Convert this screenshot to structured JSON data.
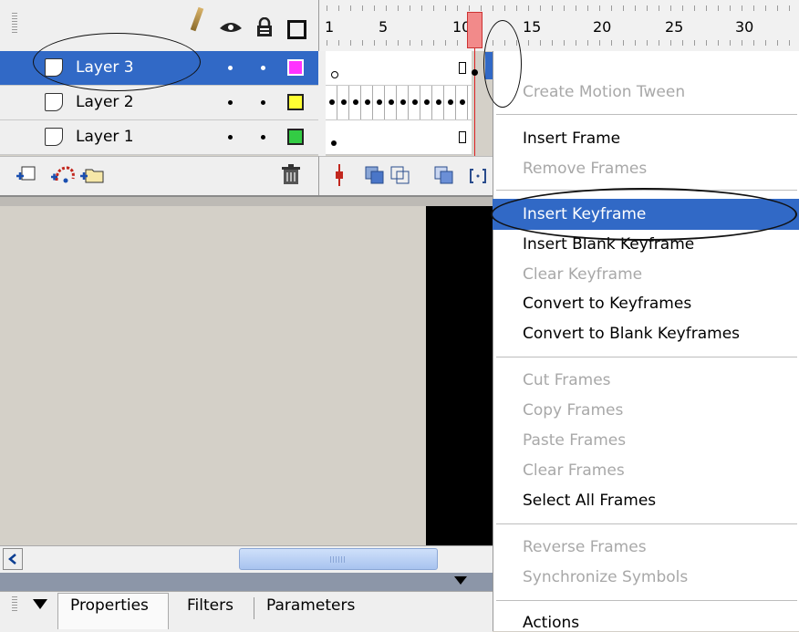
{
  "ruler": {
    "numbers": [
      "1",
      "5",
      "10",
      "15",
      "20",
      "25",
      "30"
    ]
  },
  "layers": [
    {
      "name": "Layer 3",
      "selected": true,
      "color": "#ff33ff"
    },
    {
      "name": "Layer 2",
      "selected": false,
      "color": "#ffff33"
    },
    {
      "name": "Layer 1",
      "selected": false,
      "color": "#33cc44"
    }
  ],
  "accent": "#3169c6",
  "context_menu": {
    "items": [
      {
        "label": "Create Motion Tween",
        "enabled": false
      },
      {
        "label": "Insert Frame",
        "enabled": true
      },
      {
        "label": "Remove Frames",
        "enabled": false
      },
      {
        "label": "Insert Keyframe",
        "enabled": true,
        "highlighted": true
      },
      {
        "label": "Insert Blank Keyframe",
        "enabled": true
      },
      {
        "label": "Clear Keyframe",
        "enabled": false
      },
      {
        "label": "Convert to Keyframes",
        "enabled": true
      },
      {
        "label": "Convert to Blank Keyframes",
        "enabled": true
      },
      {
        "label": "Cut Frames",
        "enabled": false
      },
      {
        "label": "Copy Frames",
        "enabled": false
      },
      {
        "label": "Paste Frames",
        "enabled": false
      },
      {
        "label": "Clear Frames",
        "enabled": false
      },
      {
        "label": "Select All Frames",
        "enabled": true
      },
      {
        "label": "Reverse Frames",
        "enabled": false
      },
      {
        "label": "Synchronize Symbols",
        "enabled": false
      },
      {
        "label": "Actions",
        "enabled": true
      }
    ]
  },
  "panel_tabs": [
    "Properties",
    "Filters",
    "Parameters"
  ],
  "icons": [
    "eye-icon",
    "lock-icon",
    "outline-icon",
    "layer-icon",
    "pencil-icon",
    "add-layer-icon",
    "add-guide-layer-icon",
    "insert-folder-icon",
    "trash-icon",
    "center-frame-icon",
    "onion-skin-icon",
    "onion-skin-outlines-icon",
    "edit-multiple-frames-icon",
    "modify-onion-markers-icon"
  ]
}
